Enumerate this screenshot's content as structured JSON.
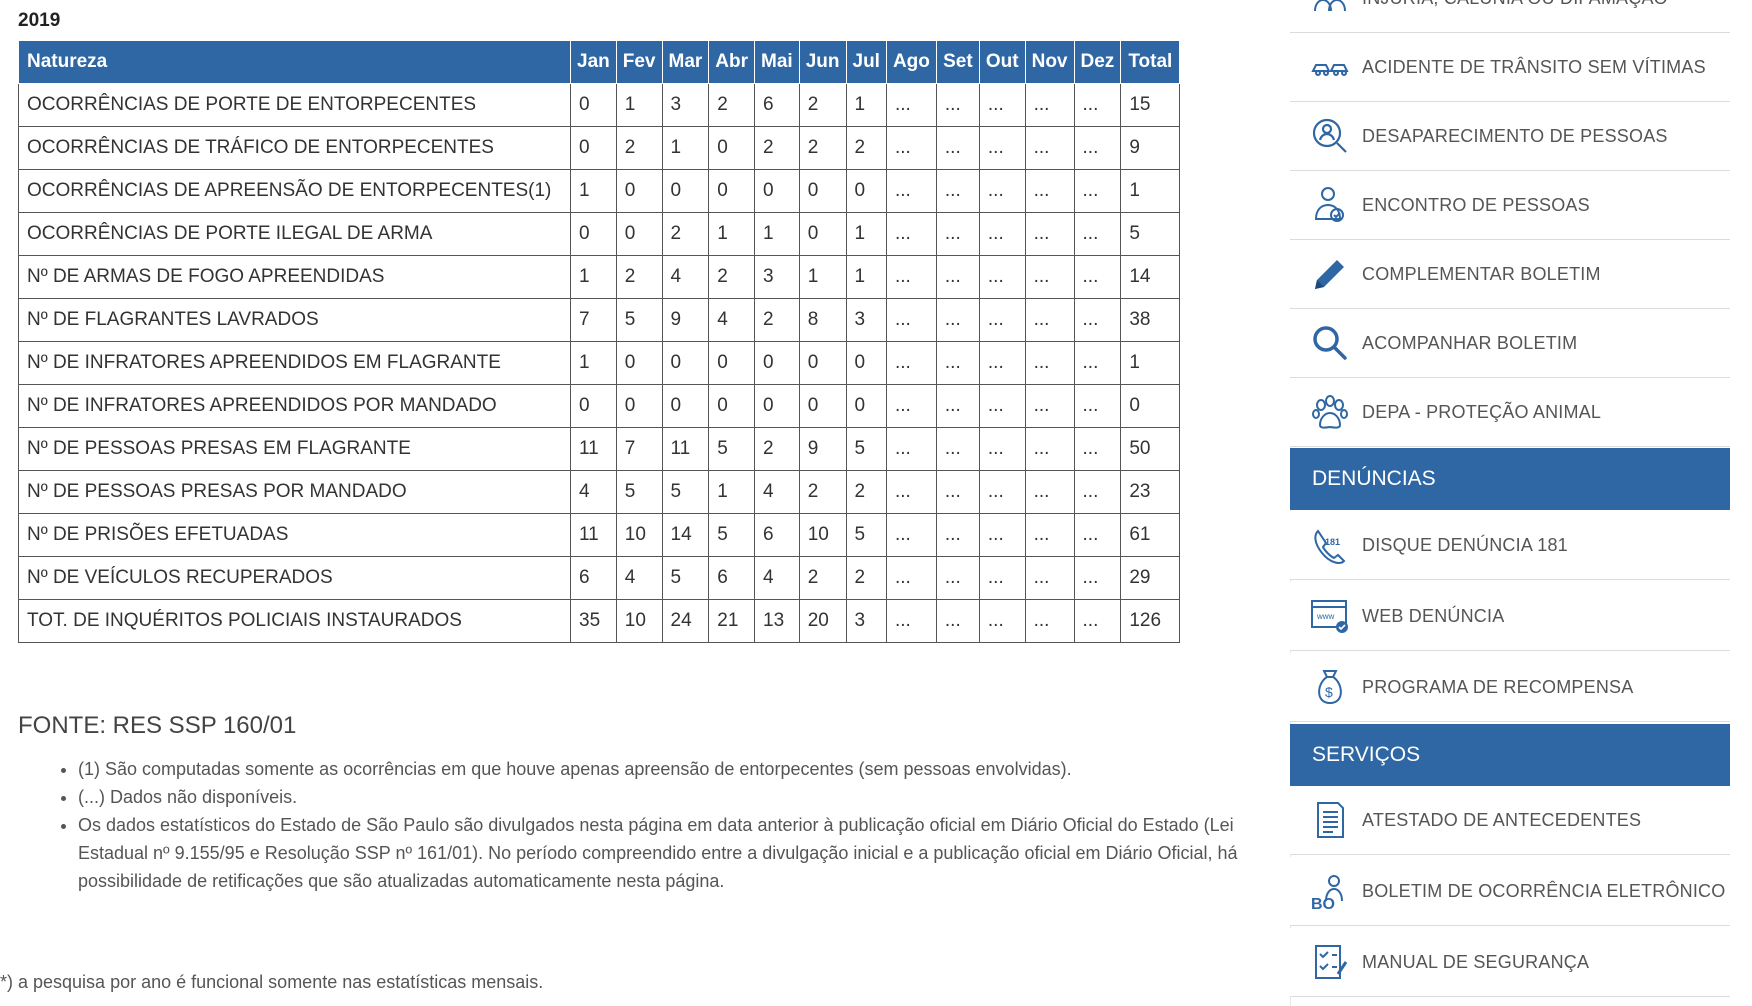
{
  "year": "2019",
  "table": {
    "headers": [
      "Natureza",
      "Jan",
      "Fev",
      "Mar",
      "Abr",
      "Mai",
      "Jun",
      "Jul",
      "Ago",
      "Set",
      "Out",
      "Nov",
      "Dez",
      "Total"
    ],
    "rows": [
      [
        "OCORRÊNCIAS DE PORTE DE ENTORPECENTES",
        "0",
        "1",
        "3",
        "2",
        "6",
        "2",
        "1",
        "...",
        "...",
        "...",
        "...",
        "...",
        "15"
      ],
      [
        "OCORRÊNCIAS DE TRÁFICO DE ENTORPECENTES",
        "0",
        "2",
        "1",
        "0",
        "2",
        "2",
        "2",
        "...",
        "...",
        "...",
        "...",
        "...",
        "9"
      ],
      [
        "OCORRÊNCIAS DE APREENSÃO DE ENTORPECENTES(1)",
        "1",
        "0",
        "0",
        "0",
        "0",
        "0",
        "0",
        "...",
        "...",
        "...",
        "...",
        "...",
        "1"
      ],
      [
        "OCORRÊNCIAS DE PORTE ILEGAL DE ARMA",
        "0",
        "0",
        "2",
        "1",
        "1",
        "0",
        "1",
        "...",
        "...",
        "...",
        "...",
        "...",
        "5"
      ],
      [
        "Nº DE ARMAS DE FOGO APREENDIDAS",
        "1",
        "2",
        "4",
        "2",
        "3",
        "1",
        "1",
        "...",
        "...",
        "...",
        "...",
        "...",
        "14"
      ],
      [
        "Nº DE FLAGRANTES LAVRADOS",
        "7",
        "5",
        "9",
        "4",
        "2",
        "8",
        "3",
        "...",
        "...",
        "...",
        "...",
        "...",
        "38"
      ],
      [
        "Nº DE INFRATORES APREENDIDOS EM FLAGRANTE",
        "1",
        "0",
        "0",
        "0",
        "0",
        "0",
        "0",
        "...",
        "...",
        "...",
        "...",
        "...",
        "1"
      ],
      [
        "Nº DE INFRATORES APREENDIDOS POR MANDADO",
        "0",
        "0",
        "0",
        "0",
        "0",
        "0",
        "0",
        "...",
        "...",
        "...",
        "...",
        "...",
        "0"
      ],
      [
        "Nº DE PESSOAS PRESAS EM FLAGRANTE",
        "11",
        "7",
        "11",
        "5",
        "2",
        "9",
        "5",
        "...",
        "...",
        "...",
        "...",
        "...",
        "50"
      ],
      [
        "Nº DE PESSOAS PRESAS POR MANDADO",
        "4",
        "5",
        "5",
        "1",
        "4",
        "2",
        "2",
        "...",
        "...",
        "...",
        "...",
        "...",
        "23"
      ],
      [
        "Nº DE PRISÕES EFETUADAS",
        "11",
        "10",
        "14",
        "5",
        "6",
        "10",
        "5",
        "...",
        "...",
        "...",
        "...",
        "...",
        "61"
      ],
      [
        "Nº DE VEÍCULOS RECUPERADOS",
        "6",
        "4",
        "5",
        "6",
        "4",
        "2",
        "2",
        "...",
        "...",
        "...",
        "...",
        "...",
        "29"
      ],
      [
        "TOT. DE INQUÉRITOS POLICIAIS INSTAURADOS",
        "35",
        "10",
        "24",
        "21",
        "13",
        "20",
        "3",
        "...",
        "...",
        "...",
        "...",
        "...",
        "126"
      ]
    ]
  },
  "fonte": "FONTE: RES SSP 160/01",
  "notes": [
    "(1) São computadas somente as ocorrências em que houve apenas apreensão de entorpecentes (sem pessoas envolvidas).",
    "(...) Dados não disponíveis.",
    "Os dados estatísticos do Estado de São Paulo são divulgados nesta página em data anterior à publicação oficial em Diário Oficial do Estado (Lei Estadual nº 9.155/95 e Resolução SSP nº 161/01). No período compreendido entre a divulgação inicial e a publicação oficial em Diário Oficial, há possibilidade de retificações que são atualizadas automaticamente nesta página."
  ],
  "search_note": "*) a pesquisa por ano é funcional somente nas estatísticas mensais.",
  "sidebar": {
    "top_items": [
      {
        "label": "INJÚRIA, CALÚNIA OU DIFAMAÇÃO",
        "icon": "people-icon"
      },
      {
        "label": "ACIDENTE DE TRÂNSITO SEM VÍTIMAS",
        "icon": "car-crash-icon"
      },
      {
        "label": "DESAPARECIMENTO DE PESSOAS",
        "icon": "person-search-icon"
      },
      {
        "label": "ENCONTRO DE PESSOAS",
        "icon": "person-found-icon"
      },
      {
        "label": "COMPLEMENTAR BOLETIM",
        "icon": "pencil-icon"
      },
      {
        "label": "ACOMPANHAR BOLETIM",
        "icon": "magnifier-icon"
      },
      {
        "label": "DEPA - PROTEÇÃO ANIMAL",
        "icon": "paw-icon"
      }
    ],
    "denuncias_title": "DENÚNCIAS",
    "denuncias_items": [
      {
        "label": "DISQUE DENÚNCIA 181",
        "icon": "phone-181-icon"
      },
      {
        "label": "WEB DENÚNCIA",
        "icon": "web-monitor-icon"
      },
      {
        "label": "PROGRAMA DE RECOMPENSA",
        "icon": "money-bag-icon"
      }
    ],
    "servicos_title": "SERVIÇOS",
    "servicos_items": [
      {
        "label": "ATESTADO DE ANTECEDENTES",
        "icon": "document-icon"
      },
      {
        "label": "BOLETIM DE OCORRÊNCIA ELETRÔNICO",
        "icon": "bo-icon"
      },
      {
        "label": "MANUAL DE SEGURANÇA",
        "icon": "checklist-icon"
      }
    ]
  }
}
